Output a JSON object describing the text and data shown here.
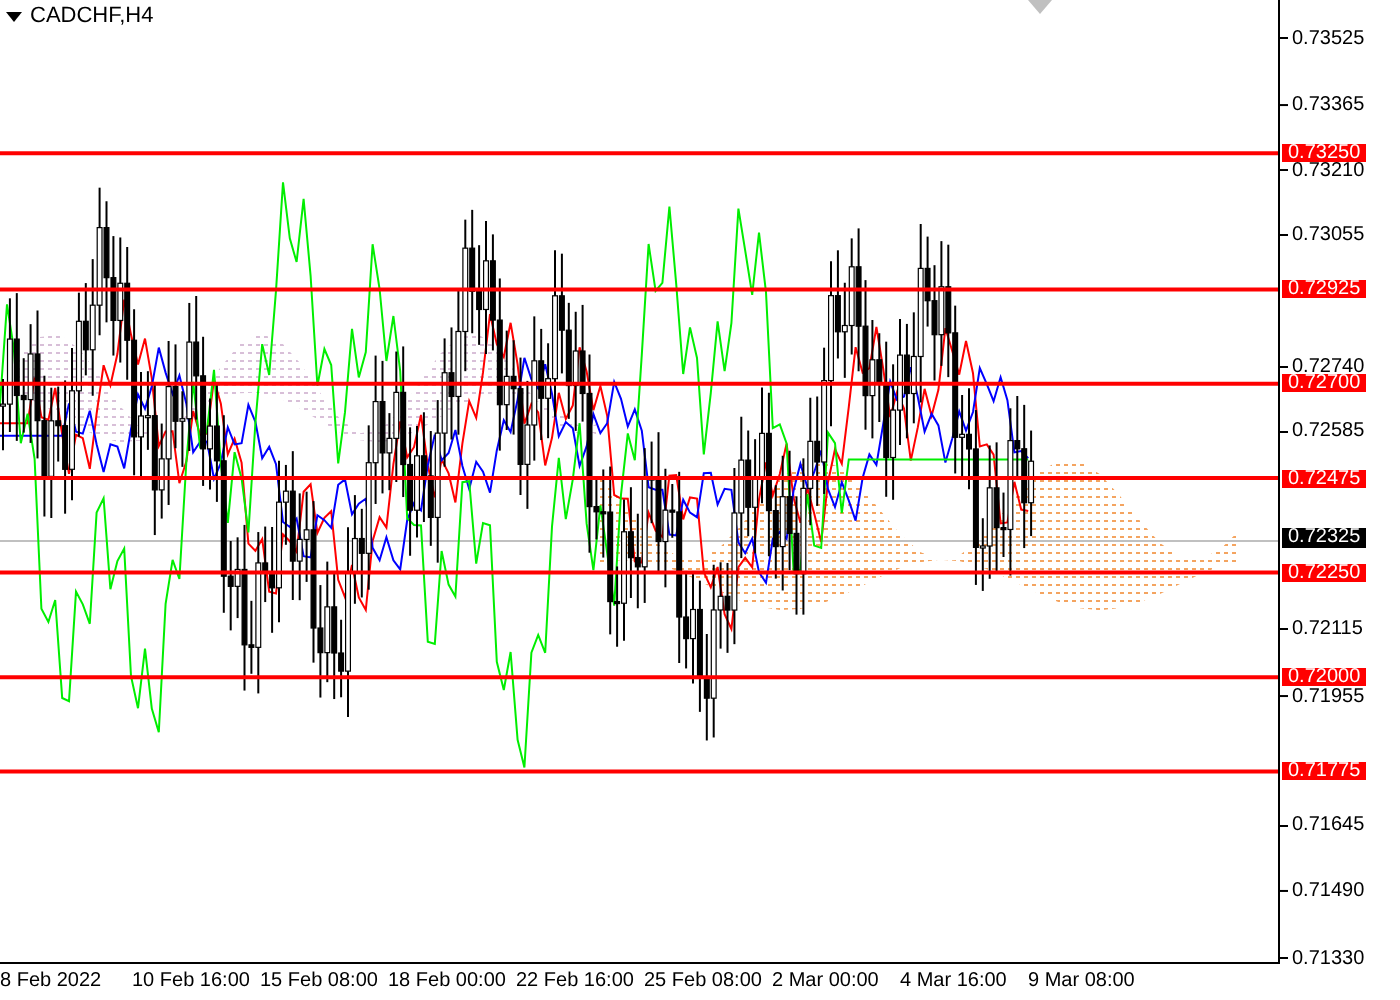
{
  "chart": {
    "symbol": "CADCHF,H4",
    "price_ticks": [
      "0.73525",
      "0.73365",
      "0.73210",
      "0.73055",
      "0.72740",
      "0.72585",
      "0.72115",
      "0.71955",
      "0.71645",
      "0.71490",
      "0.71330"
    ],
    "levels": [
      "0.73250",
      "0.72925",
      "0.72700",
      "0.72475",
      "0.72250",
      "0.72000",
      "0.71775"
    ],
    "current_price": "0.72325",
    "time_labels": [
      "8 Feb 2022",
      "10 Feb 16:00",
      "15 Feb 08:00",
      "18 Feb 00:00",
      "22 Feb 16:00",
      "25 Feb 08:00",
      "2 Mar 00:00",
      "4 Mar 16:00",
      "9 Mar 08:00"
    ]
  }
}
